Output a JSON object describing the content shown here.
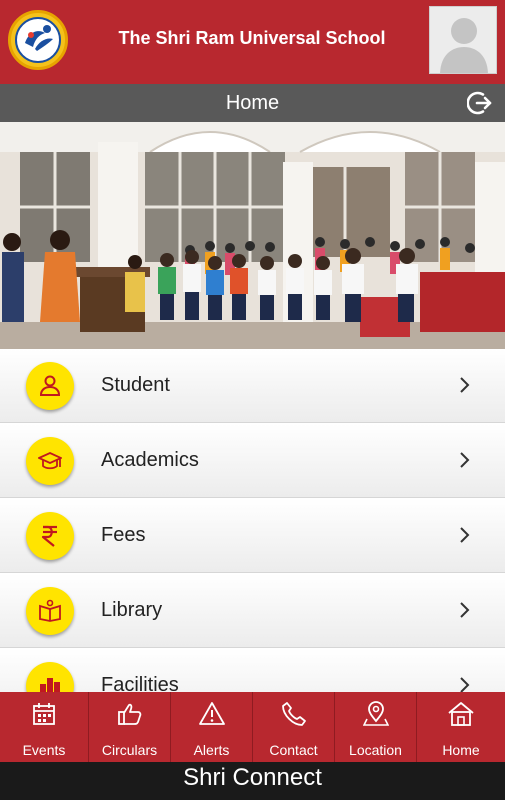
{
  "header": {
    "school_name": "The Shri Ram Universal School"
  },
  "titlebar": {
    "title": "Home"
  },
  "menu": [
    {
      "label": "Student",
      "icon": "student-icon"
    },
    {
      "label": "Academics",
      "icon": "graduation-cap-icon"
    },
    {
      "label": "Fees",
      "icon": "rupee-icon"
    },
    {
      "label": "Library",
      "icon": "book-icon"
    },
    {
      "label": "Facilities",
      "icon": "building-icon"
    }
  ],
  "bottom_nav": [
    {
      "label": "Events",
      "icon": "calendar-icon"
    },
    {
      "label": "Circulars",
      "icon": "thumbs-up-icon"
    },
    {
      "label": "Alerts",
      "icon": "warning-icon"
    },
    {
      "label": "Contact",
      "icon": "phone-icon"
    },
    {
      "label": "Location",
      "icon": "map-pin-icon"
    },
    {
      "label": "Home",
      "icon": "home-icon"
    }
  ],
  "footer": {
    "text": "Shri Connect"
  },
  "colors": {
    "brand_red": "#b8282f",
    "titlebar_gray": "#595959",
    "icon_yellow": "#ffe400",
    "footer_black": "#1a1a1a"
  }
}
